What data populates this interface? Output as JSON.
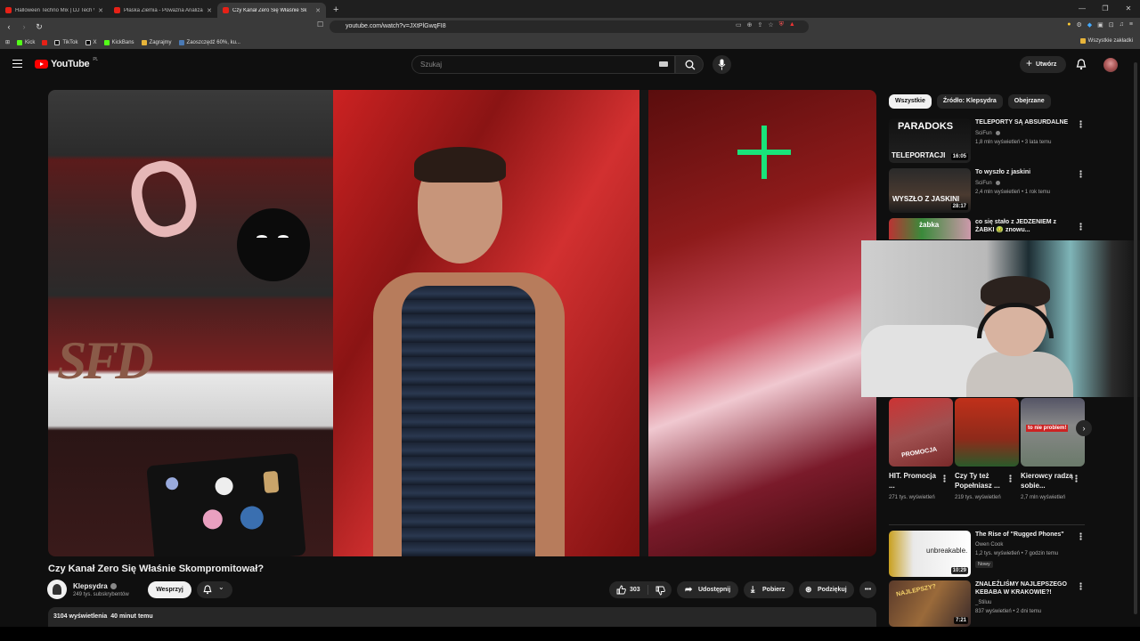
{
  "browser": {
    "tabs": [
      {
        "title": "Halloween Techno Mix | DJ Tech Wic"
      },
      {
        "title": "Płaska Ziemia - Poważna Analiza [cz."
      },
      {
        "title": "Czy Kanał Zero Się Właśnie Sk",
        "active": true
      }
    ],
    "url": "youtube.com/watch?v=JXtPlGwqFI8",
    "bookmarks": [
      "Kick",
      "TikTok",
      "X",
      "KickBans",
      "Zagrajmy",
      "Zaoszczędź 60%, ku..."
    ],
    "all_bookmarks": "Wszystkie zakładki"
  },
  "header": {
    "logo": "YouTube",
    "region": "PL",
    "search_placeholder": "Szukaj",
    "create_label": "Utwórz"
  },
  "video": {
    "title": "Czy Kanał Zero Się Właśnie Skompromitował?",
    "channel": "Klepsydra",
    "subscribers": "249 tys. subskrybentów",
    "join_label": "Wesprzyj",
    "likes": "303",
    "share_label": "Udostępnij",
    "download_label": "Pobierz",
    "thanks_label": "Podziękuj",
    "views": "3104 wyświetlenia",
    "time": "40 minut temu",
    "overlay_logo": "SFD"
  },
  "sidebar": {
    "chips": [
      "Wszystkie",
      "Źródło: Klepsydra",
      "Obejrzane"
    ],
    "recs_top": [
      {
        "title": "TELEPORTY SĄ ABSURDALNE",
        "channel": "SciFun",
        "meta": "1,8 mln wyświetleń • 3 lata temu",
        "duration": "16:05",
        "thumb_text1": "PARADOKS",
        "thumb_text2": "TELEPORTACJI"
      },
      {
        "title": "To wyszło z jaskini",
        "channel": "SciFun",
        "meta": "2,4 mln wyświetleń • 1 rok temu",
        "duration": "28:17",
        "thumb_text1": "WYSZŁO Z JASKINI"
      },
      {
        "title": "co się stało z JEDZENIEM z ŻABKI 🤢 znowu...",
        "thumb_text1": "żabka"
      }
    ],
    "shorts": [
      {
        "title": "HIT. Promocja ...",
        "views": "271 tys. wyświetleń",
        "thumb_text": "PROMOCJA"
      },
      {
        "title": "Czy Ty też Popełniasz ...",
        "views": "219 tys. wyświetleń",
        "thumb_text": ""
      },
      {
        "title": "Kierowcy radzą sobie...",
        "views": "2,7 mln wyświetleń",
        "thumb_text": "to nie problem!"
      }
    ],
    "recs_bottom": [
      {
        "title": "The Rise of \"Rugged Phones\"",
        "channel": "Owen Cook",
        "meta": "1,2 tys. wyświetleń • 7 godzin temu",
        "badge": "Nowy",
        "duration": "10:29",
        "thumb_text": "unbreakable."
      },
      {
        "title": "ZNALEŹLIŚMY NAJLEPSZEGO KEBABA W KRAKOWIE?!",
        "channel": "_Stiluu",
        "meta": "837 wyświetleń • 2 dni temu",
        "duration": "7:21",
        "thumb_text": "NAJLEPSZY?"
      }
    ]
  }
}
